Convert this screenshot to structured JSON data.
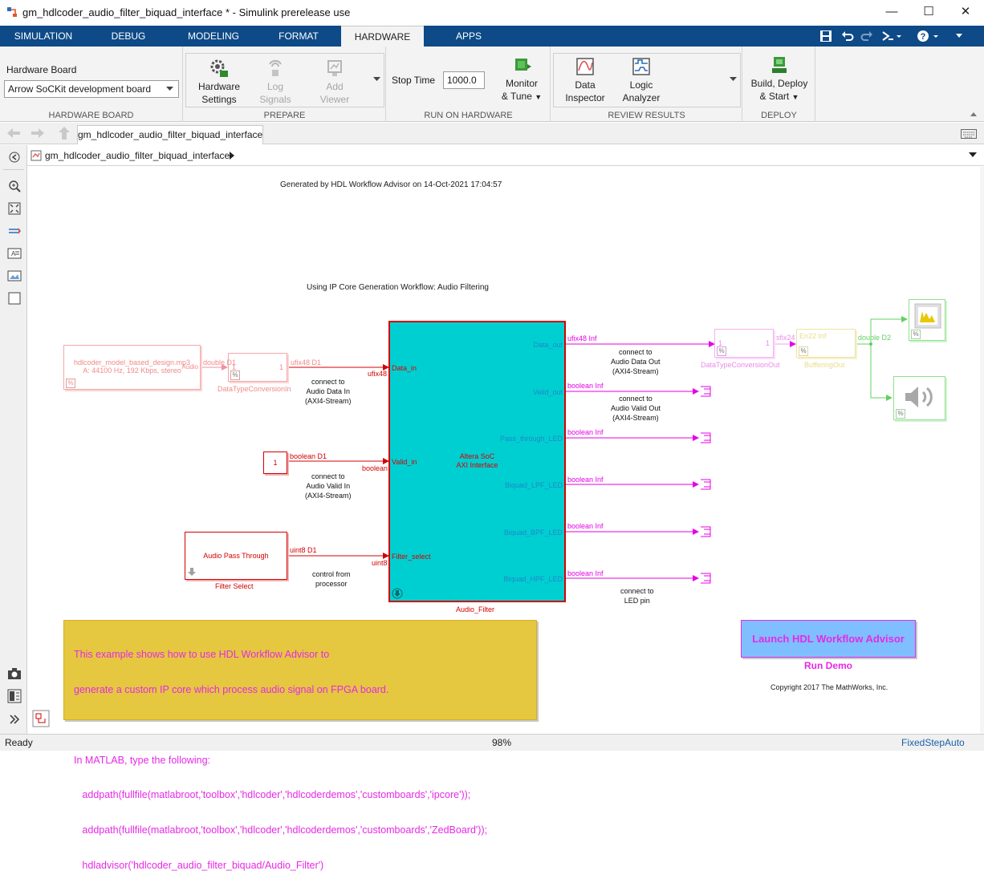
{
  "window": {
    "title": "gm_hdlcoder_audio_filter_biquad_interface * - Simulink prerelease use"
  },
  "tabs": [
    "SIMULATION",
    "DEBUG",
    "MODELING",
    "FORMAT",
    "HARDWARE",
    "APPS"
  ],
  "ribbon": {
    "hardware_board": {
      "label": "Hardware Board",
      "value": "Arrow SoCKit development board",
      "section": "HARDWARE BOARD"
    },
    "prepare": {
      "section": "PREPARE",
      "hardware_settings": [
        "Hardware",
        "Settings"
      ],
      "log_signals": [
        "Log",
        "Signals"
      ],
      "add_viewer": [
        "Add",
        "Viewer"
      ]
    },
    "run": {
      "section": "RUN ON HARDWARE",
      "stop_time_label": "Stop Time",
      "stop_time_value": "1000.0",
      "monitor_tune": [
        "Monitor",
        "& Tune"
      ]
    },
    "review": {
      "section": "REVIEW RESULTS",
      "data_inspector": [
        "Data",
        "Inspector"
      ],
      "logic_analyzer": [
        "Logic",
        "Analyzer"
      ]
    },
    "deploy": {
      "section": "DEPLOY",
      "build_deploy": [
        "Build, Deploy",
        "& Start"
      ]
    }
  },
  "model_tab": "gm_hdlcoder_audio_filter_biquad_interface",
  "breadcrumb": "gm_hdlcoder_audio_filter_biquad_interface",
  "diagram": {
    "generated_note": "Generated by HDL Workflow Advisor on 14-Oct-2021 17:04:57",
    "subtitle": "Using IP Core Generation Workflow: Audio Filtering",
    "source": {
      "line1": "hdlcoder_model_based_design.mp3",
      "line2": "A: 44100 Hz, 192 Kbps, stereo",
      "port": "Audio",
      "pct": "%"
    },
    "dtc_in": {
      "name": "DataTypeConversionIn",
      "in_sig": "double D1",
      "out_sig": "ufix48 D1",
      "one_a": "1",
      "one_b": "1"
    },
    "const_block": {
      "value": "1",
      "sig": "boolean D1"
    },
    "filter_select": {
      "label": "Audio Pass Through",
      "name": "Filter Select",
      "sig": "uint8 D1"
    },
    "subsystem": {
      "title1": "Altera SoC",
      "title2": "AXI Interface",
      "name": "Audio_Filter",
      "in_ports": [
        "Data_in",
        "Valid_in",
        "Filter_select"
      ],
      "in_types": [
        "ufix48",
        "boolean",
        "uint8"
      ],
      "out_ports": [
        "Data_out",
        "Valid_out",
        "Pass_through_LED",
        "Biquad_LPF_LED",
        "Biquad_BPF_LED",
        "Biquad_HPF_LED"
      ],
      "out_sigs": [
        "ufix48 Inf",
        "boolean Inf",
        "boolean Inf",
        "boolean Inf",
        "boolean Inf",
        "boolean Inf"
      ]
    },
    "notes": {
      "data_in": [
        "connect to",
        "Audio Data In",
        "(AXI4-Stream)"
      ],
      "valid_in": [
        "connect to",
        "Audio Valid In",
        "(AXI4-Stream)"
      ],
      "control": [
        "control from",
        "processor"
      ],
      "data_out": [
        "connect to",
        "Audio Data Out",
        "(AXI4-Stream)"
      ],
      "valid_out": [
        "connect to",
        "Audio Valid Out",
        "(AXI4-Stream)"
      ],
      "led": [
        "connect to",
        "LED pin"
      ]
    },
    "dtc_out": {
      "name": "DataTypeConversionOut",
      "out_sig": "sfix24",
      "one_a": "1",
      "one_b": "1"
    },
    "buffering": {
      "name": "BufferingOut",
      "label": "Buffer",
      "in_sig": "En22 Inf",
      "out_sig": "double D2"
    },
    "info_text": [
      "This example shows how to use HDL Workflow Advisor to",
      "generate a custom IP core which process audio signal on FPGA board.",
      "",
      "In MATLAB, type the following:",
      "   addpath(fullfile(matlabroot,'toolbox','hdlcoder','hdlcoderdemos','customboards','ipcore'));",
      "   addpath(fullfile(matlabroot,'toolbox','hdlcoder','hdlcoderdemos','customboards','ZedBoard'));",
      "   hdladvisor('hdlcoder_audio_filter_biquad/Audio_Filter')"
    ],
    "launch_button": "Launch HDL Workflow Advisor",
    "run_demo": "Run Demo",
    "copyright": "Copyright 2017 The MathWorks, Inc."
  },
  "status": {
    "left": "Ready",
    "zoom": "98%",
    "solver": "FixedStepAuto"
  },
  "colors": {
    "tabbar": "#0d4a87",
    "subsystem": "#00cfd1",
    "signal_red": "#d40000",
    "signal_magenta": "#e600e6",
    "note_bg": "#e5c740",
    "launch_bg": "#7fbfff"
  }
}
